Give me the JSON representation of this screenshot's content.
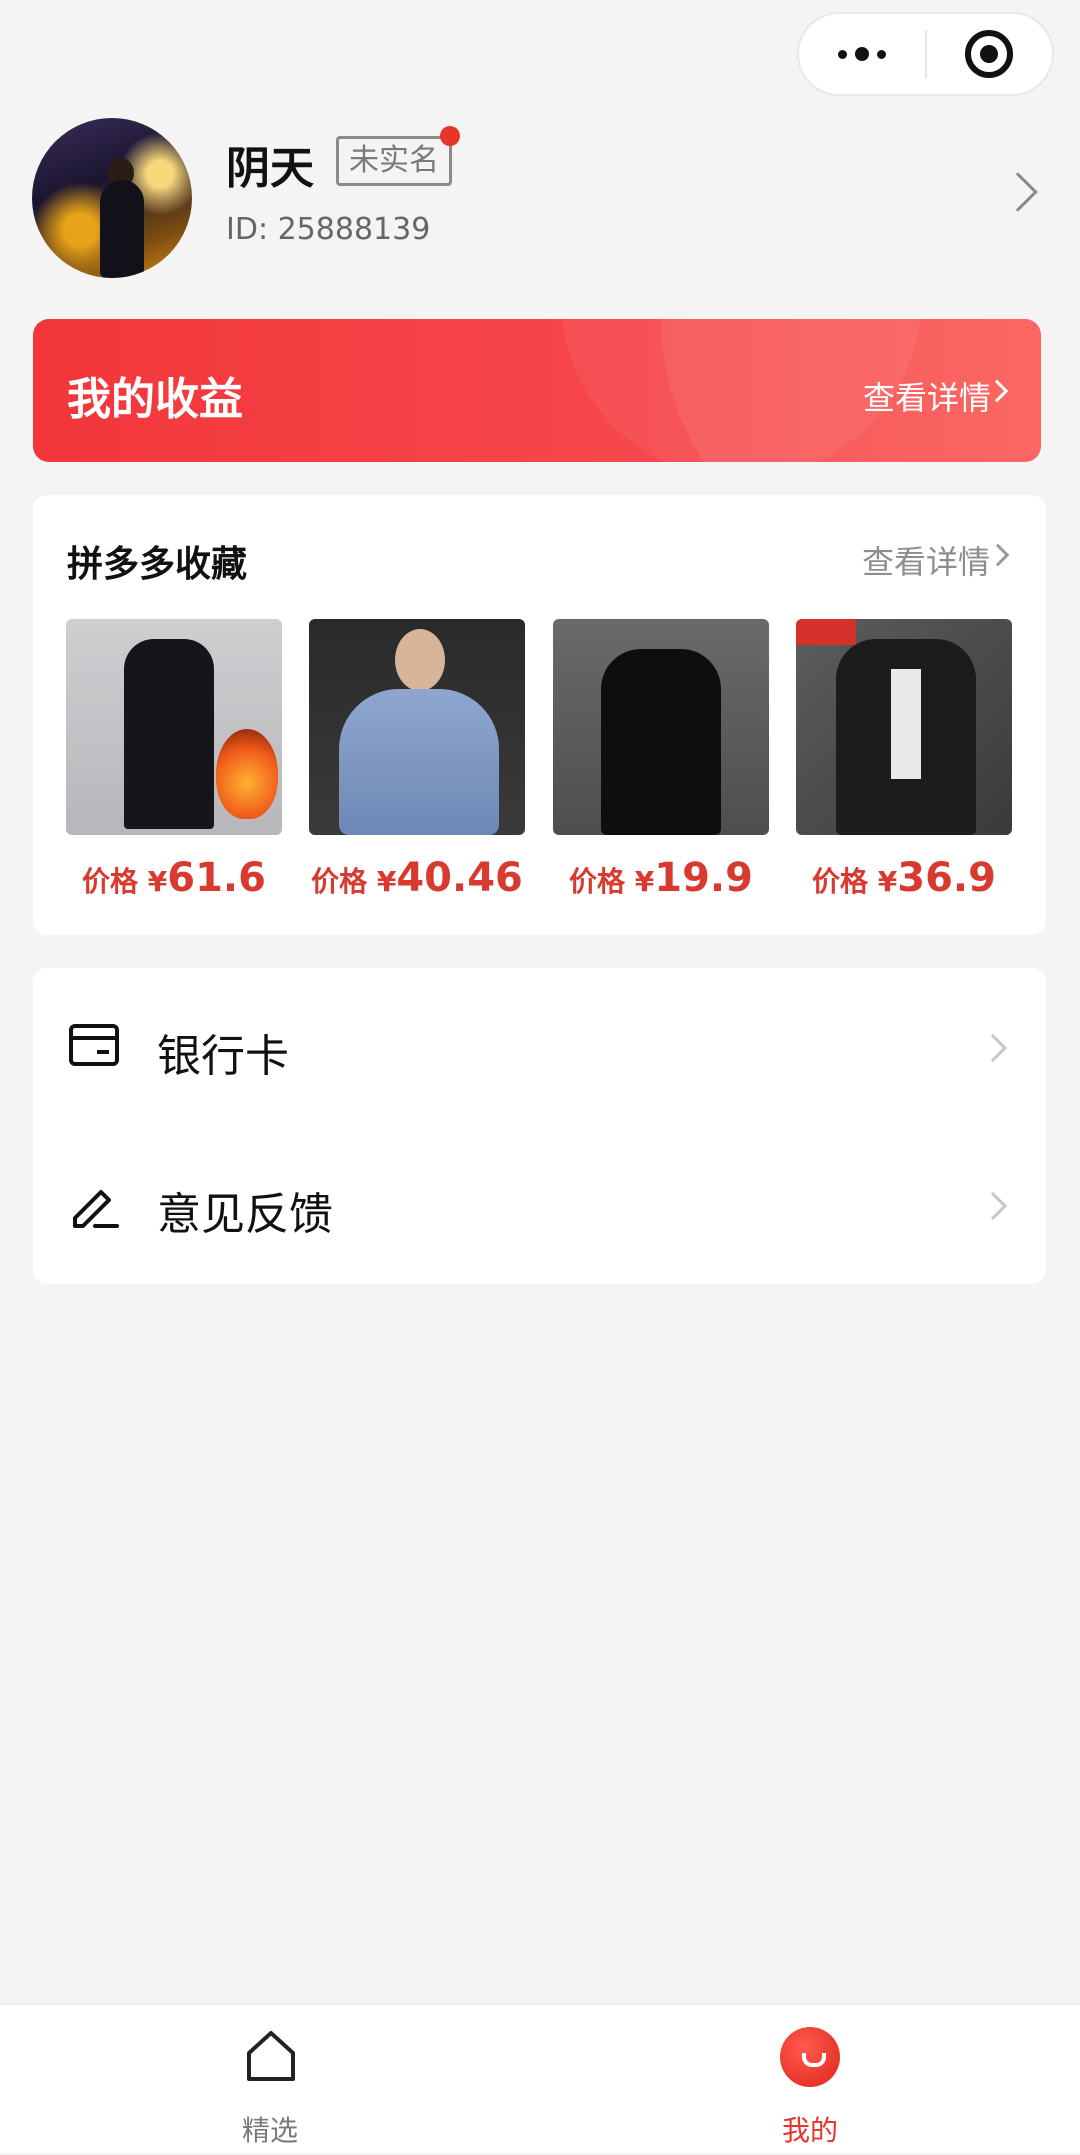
{
  "profile": {
    "name": "阴天",
    "verify_badge": "未实名",
    "user_id": "ID: 25888139"
  },
  "earnings": {
    "title": "我的收益",
    "link": "查看详情"
  },
  "favorites": {
    "title": "拼多多收藏",
    "link": "查看详情",
    "items": [
      {
        "price_label": "价格 ¥",
        "price": "61.6"
      },
      {
        "price_label": "价格 ¥",
        "price": "40.46"
      },
      {
        "price_label": "价格 ¥",
        "price": "19.9"
      },
      {
        "price_label": "价格 ¥",
        "price": "36.9"
      }
    ]
  },
  "menu": {
    "items": [
      {
        "label": "银行卡",
        "icon": "bank-card-icon"
      },
      {
        "label": "意见反馈",
        "icon": "edit-pen-icon"
      }
    ]
  },
  "tabbar": {
    "tabs": [
      {
        "label": "精选",
        "icon": "home-icon",
        "active": false
      },
      {
        "label": "我的",
        "icon": "profile-icon",
        "active": true
      }
    ]
  },
  "colors": {
    "accent": "#e8352b",
    "background": "#f4f4f4",
    "price": "#d93a2f"
  }
}
